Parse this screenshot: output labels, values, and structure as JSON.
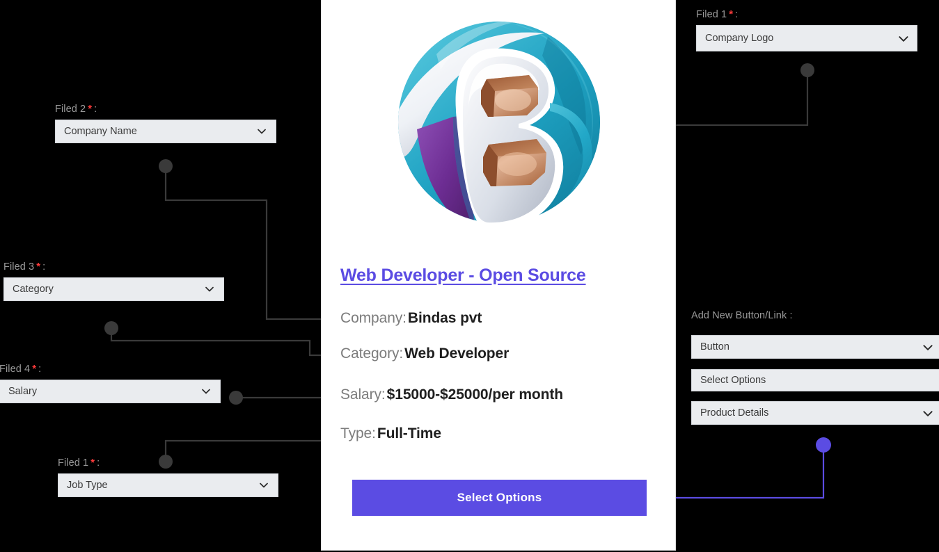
{
  "theme": {
    "canvas_bg": "#000000",
    "card_bg": "#ffffff",
    "field_bg": "#eaecef",
    "label_color": "#9a9a9a",
    "required_color": "#ff3b3b",
    "accent_purple": "#5b4ce3",
    "connector_gray": "#3a3a3a"
  },
  "left_fields": [
    {
      "label": "Filed 2",
      "required": "*",
      "colon": ":",
      "value": "Company Name",
      "icon": "chevron-down-icon"
    },
    {
      "label": "Filed 3",
      "required": "*",
      "colon": ":",
      "value": "Category",
      "icon": "chevron-down-icon"
    },
    {
      "label": "Filed 4",
      "required": "*",
      "colon": ":",
      "value": "Salary",
      "icon": "chevron-down-icon"
    },
    {
      "label": "Filed 1",
      "required": "*",
      "colon": ":",
      "value": "Job Type",
      "icon": "chevron-down-icon"
    }
  ],
  "right_fields": {
    "top": {
      "label": "Filed 1",
      "required": "*",
      "colon": ":",
      "value": "Company Logo",
      "icon": "chevron-down-icon"
    },
    "group_label": "Add New Button/Link :",
    "items": [
      {
        "value": "Button",
        "icon": "chevron-down-icon",
        "has_chevron": true
      },
      {
        "value": "Select Options",
        "icon": "",
        "has_chevron": false
      },
      {
        "value": "Product Details",
        "icon": "chevron-down-icon",
        "has_chevron": true
      }
    ]
  },
  "card": {
    "logo_alt": "bindas-b-logo",
    "title": "Web Developer - Open Source",
    "meta": [
      {
        "key": "Company:",
        "value": "Bindas pvt"
      },
      {
        "key": "Category:",
        "value": "Web Developer"
      },
      {
        "key": "Salary:",
        "value": "$15000-$25000/per month"
      },
      {
        "key": "Type:",
        "value": "Full-Time"
      }
    ],
    "button_label": "Select Options"
  }
}
